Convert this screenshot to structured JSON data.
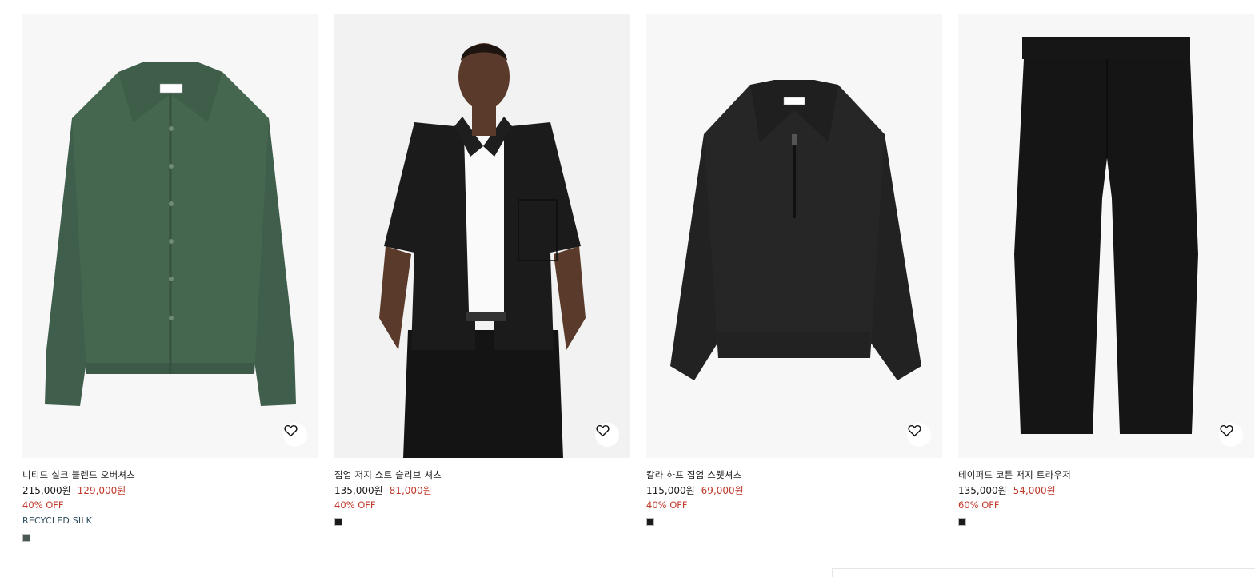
{
  "products": [
    {
      "name": "니티드 실크 블렌드 오버셔츠",
      "old_price": "215,000원",
      "new_price": "129,000원",
      "discount": "40% OFF",
      "tag": "RECYCLED SILK",
      "swatch_color": "#4a5a52",
      "wishlist_icon": "heart-icon"
    },
    {
      "name": "집업 저지 쇼트 슬리브 셔츠",
      "old_price": "135,000원",
      "new_price": "81,000원",
      "discount": "40% OFF",
      "swatch_color": "#1a1a1a",
      "wishlist_icon": "heart-icon"
    },
    {
      "name": "칼라 하프 집업 스웻셔츠",
      "old_price": "115,000원",
      "new_price": "69,000원",
      "discount": "40% OFF",
      "swatch_color": "#1a1a1a",
      "wishlist_icon": "heart-icon"
    },
    {
      "name": "테이퍼드 코튼 저지 트라우저",
      "old_price": "135,000원",
      "new_price": "54,000원",
      "discount": "60% OFF",
      "swatch_color": "#1a1a1a",
      "wishlist_icon": "heart-icon"
    }
  ],
  "colors": {
    "sale_red": "#c0392b",
    "tag_blue": "#2c4a5a",
    "image_bg": "#f6f6f6"
  }
}
